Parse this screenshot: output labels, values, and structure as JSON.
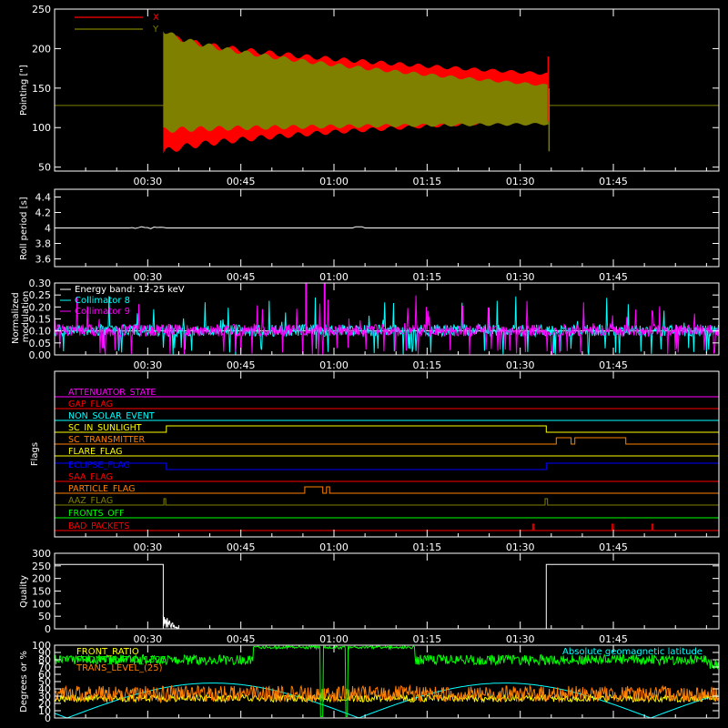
{
  "chart_data": [
    {
      "id": "pointing",
      "type": "line",
      "ylabel": "Pointing [\"]",
      "ylim": [
        45,
        250
      ],
      "yticks": [
        50,
        100,
        150,
        200,
        250
      ],
      "xticks": [
        "00:30",
        "00:45",
        "01:00",
        "01:15",
        "01:30",
        "01:45"
      ],
      "xlim_minutes": [
        15,
        122
      ],
      "legend_position": "top-left",
      "baseline": 128,
      "series": [
        {
          "name": "X",
          "color": "#ff0000",
          "start_min": 32.5,
          "stop_min": 94.5,
          "start_range": [
            62,
            225
          ],
          "end_range": [
            108,
            170
          ]
        },
        {
          "name": "Y",
          "color": "#808000",
          "start_min": 32.5,
          "stop_min": 94.5,
          "start_range": [
            92,
            230
          ],
          "end_range": [
            103,
            155
          ]
        }
      ]
    },
    {
      "id": "roll",
      "type": "line",
      "ylabel": "Roll period [s]",
      "ylim": [
        3.5,
        4.5
      ],
      "yticks": [
        3.6,
        3.8,
        4.0,
        4.2,
        4.4
      ],
      "xticks": [
        "00:30",
        "00:45",
        "01:00",
        "01:15",
        "01:30",
        "01:45"
      ],
      "xlim_minutes": [
        15,
        122
      ],
      "series": [
        {
          "name": "",
          "color": "#ffffff",
          "value": 4.0
        }
      ]
    },
    {
      "id": "modulation",
      "type": "line",
      "ylabel": "Normalized modulation",
      "ylim": [
        0,
        0.3
      ],
      "yticks": [
        "0.00",
        "0.05",
        "0.10",
        "0.15",
        "0.20",
        "0.25",
        "0.30"
      ],
      "xticks": [
        "00:30",
        "00:45",
        "01:00",
        "01:15",
        "01:30",
        "01:45"
      ],
      "xlim_minutes": [
        15,
        122
      ],
      "legend": [
        "Energy band: 12-25 keV",
        "Collimator 8",
        "Collimator 9"
      ],
      "legend_colors": [
        "#ffffff",
        "#00ffff",
        "#ff00ff"
      ],
      "baseline": 0.1
    },
    {
      "id": "flags",
      "type": "line",
      "ylabel": "Flags",
      "xticks": [
        "00:30",
        "00:45",
        "01:00",
        "01:15",
        "01:30",
        "01:45"
      ],
      "xlim_minutes": [
        15,
        122
      ],
      "flags": [
        {
          "label": "ATTENUATOR_STATE",
          "color": "#ff00ff",
          "high": []
        },
        {
          "label": "GAP_FLAG",
          "color": "#ff0000",
          "high": []
        },
        {
          "label": "NON_SOLAR_EVENT",
          "color": "#00ffff",
          "high": []
        },
        {
          "label": "SC_IN_SUNLIGHT",
          "color": "#ffff00",
          "high": [
            [
              33,
              94.2
            ]
          ]
        },
        {
          "label": "SC_TRANSMITTER",
          "color": "#ff8000",
          "high": [
            [
              95.8,
              98.2
            ],
            [
              98.8,
              107
            ]
          ]
        },
        {
          "label": "FLARE_FLAG",
          "color": "#ffff00",
          "high": []
        },
        {
          "label": "ECLIPSE_FLAG",
          "color": "#0000ff",
          "high": [
            [
              15,
              33
            ],
            [
              94.2,
              122
            ]
          ]
        },
        {
          "label": "SAA_FLAG",
          "color": "#ff0000",
          "high": []
        },
        {
          "label": "PARTICLE_FLAG",
          "color": "#ff8000",
          "high": [
            [
              55.3,
              58.2
            ],
            [
              58.8,
              59.3
            ]
          ]
        },
        {
          "label": "AAZ_FLAG",
          "color": "#808000",
          "high": [
            [
              32.6,
              32.9
            ],
            [
              94,
              94.4
            ]
          ]
        },
        {
          "label": "FRONTS_OFF",
          "color": "#00ff00",
          "high": []
        },
        {
          "label": "BAD_PACKETS",
          "color": "#ff0000",
          "high": [
            [
              92,
              92.2
            ],
            [
              104.8,
              105
            ],
            [
              111.2,
              111.4
            ]
          ]
        }
      ]
    },
    {
      "id": "quality",
      "type": "line",
      "ylabel": "Quality",
      "ylim": [
        0,
        300
      ],
      "yticks": [
        0,
        50,
        100,
        150,
        200,
        250,
        300
      ],
      "xticks": [
        "00:30",
        "00:45",
        "01:00",
        "01:15",
        "01:30",
        "01:45"
      ],
      "xlim_minutes": [
        15,
        122
      ],
      "series": [
        {
          "name": "",
          "color": "#ffffff",
          "segments": [
            [
              15,
              32.5,
              256
            ],
            [
              32.5,
              94.2,
              0
            ],
            [
              94.2,
              122,
              256
            ]
          ]
        }
      ]
    },
    {
      "id": "degrees",
      "type": "line",
      "ylabel": "Degrees or %",
      "ylim": [
        0,
        100
      ],
      "yticks": [
        0,
        10,
        20,
        30,
        40,
        50,
        60,
        70,
        80,
        90,
        100
      ],
      "xlim_minutes": [
        15,
        122
      ],
      "legend": [
        "FRONT_RATIO",
        "FRONT_RATIO_1325",
        "TRANS_LEVEL_(25)"
      ],
      "legend_colors": [
        "#ffff00",
        "#00ff00",
        "#ff8000"
      ],
      "annotation": "Absolute geomagnetic latitude",
      "annotation_color": "#00ffff"
    }
  ]
}
